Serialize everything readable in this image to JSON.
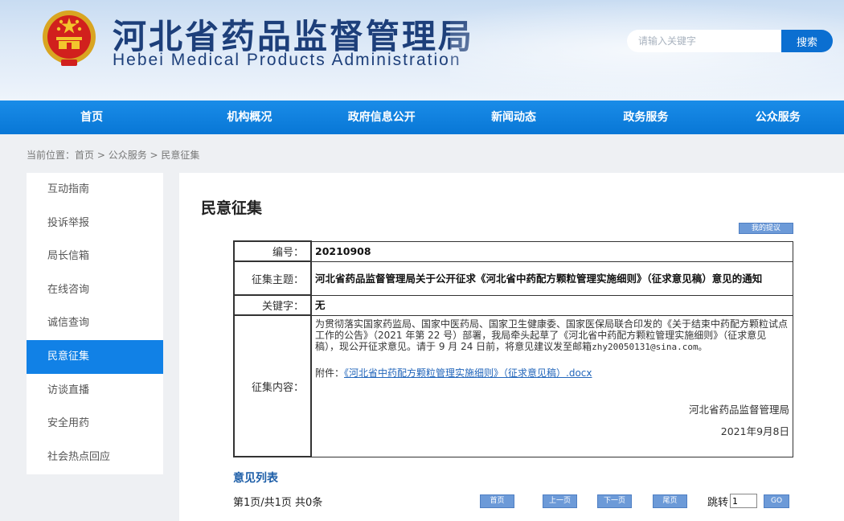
{
  "header": {
    "title": "河北省药品监督管理局",
    "subtitle": "Hebei Medical Products Administration",
    "search_placeholder": "请输入关键字",
    "search_button": "搜索",
    "emblem_icon": "national-emblem-icon"
  },
  "nav": {
    "items": [
      "首页",
      "机构概况",
      "政府信息公开",
      "新闻动态",
      "政务服务",
      "公众服务"
    ]
  },
  "breadcrumb": {
    "prefix": "当前位置：",
    "path": "首页 > 公众服务 > 民意征集"
  },
  "sidebar": {
    "items": [
      "互动指南",
      "投诉举报",
      "局长信箱",
      "在线咨询",
      "诚信查询",
      "民意征集",
      "访谈直播",
      "安全用药",
      "社会热点回应"
    ],
    "active": "民意征集"
  },
  "main": {
    "title": "民意征集",
    "suggest_button": "我的提议",
    "labels": {
      "number": "编号：",
      "subject": "征集主题：",
      "keywords": "关键字：",
      "content": "征集内容："
    },
    "number": "20210908",
    "subject": "河北省药品监督管理局关于公开征求《河北省中药配方颗粒管理实施细则》（征求意见稿）意见的通知",
    "keywords": "无",
    "content_text": "为贯彻落实国家药监局、国家中医药局、国家卫生健康委、国家医保局联合印发的《关于结束中药配方颗粒试点工作的公告》（2021 年第 22 号）部署，我局牵头起草了《河北省中药配方颗粒管理实施细则》（征求意见稿），现公开征求意见。请于 9 月 24 日前，将意见建议发至邮箱",
    "content_email": "zhy20050131@sina.com。",
    "attachment_label": "附件：",
    "attachment_link": "《河北省中药配方颗粒管理实施细则》（征求意见稿）.docx",
    "signature_org": "河北省药品监督管理局",
    "signature_date": "2021年9月8日"
  },
  "opinions": {
    "title": "意见列表",
    "pager_info": "第1页/共1页 共0条",
    "first": "首页",
    "prev": "上一页",
    "next": "下一页",
    "last": "尾页",
    "jump_label": "跳转",
    "jump_value": "1",
    "go": "GO"
  },
  "colors": {
    "nav_blue": "#0b7fdc",
    "active_blue": "#1181e6",
    "title_navy": "#1d3f7a",
    "pager_button": "#6c9ad8"
  }
}
